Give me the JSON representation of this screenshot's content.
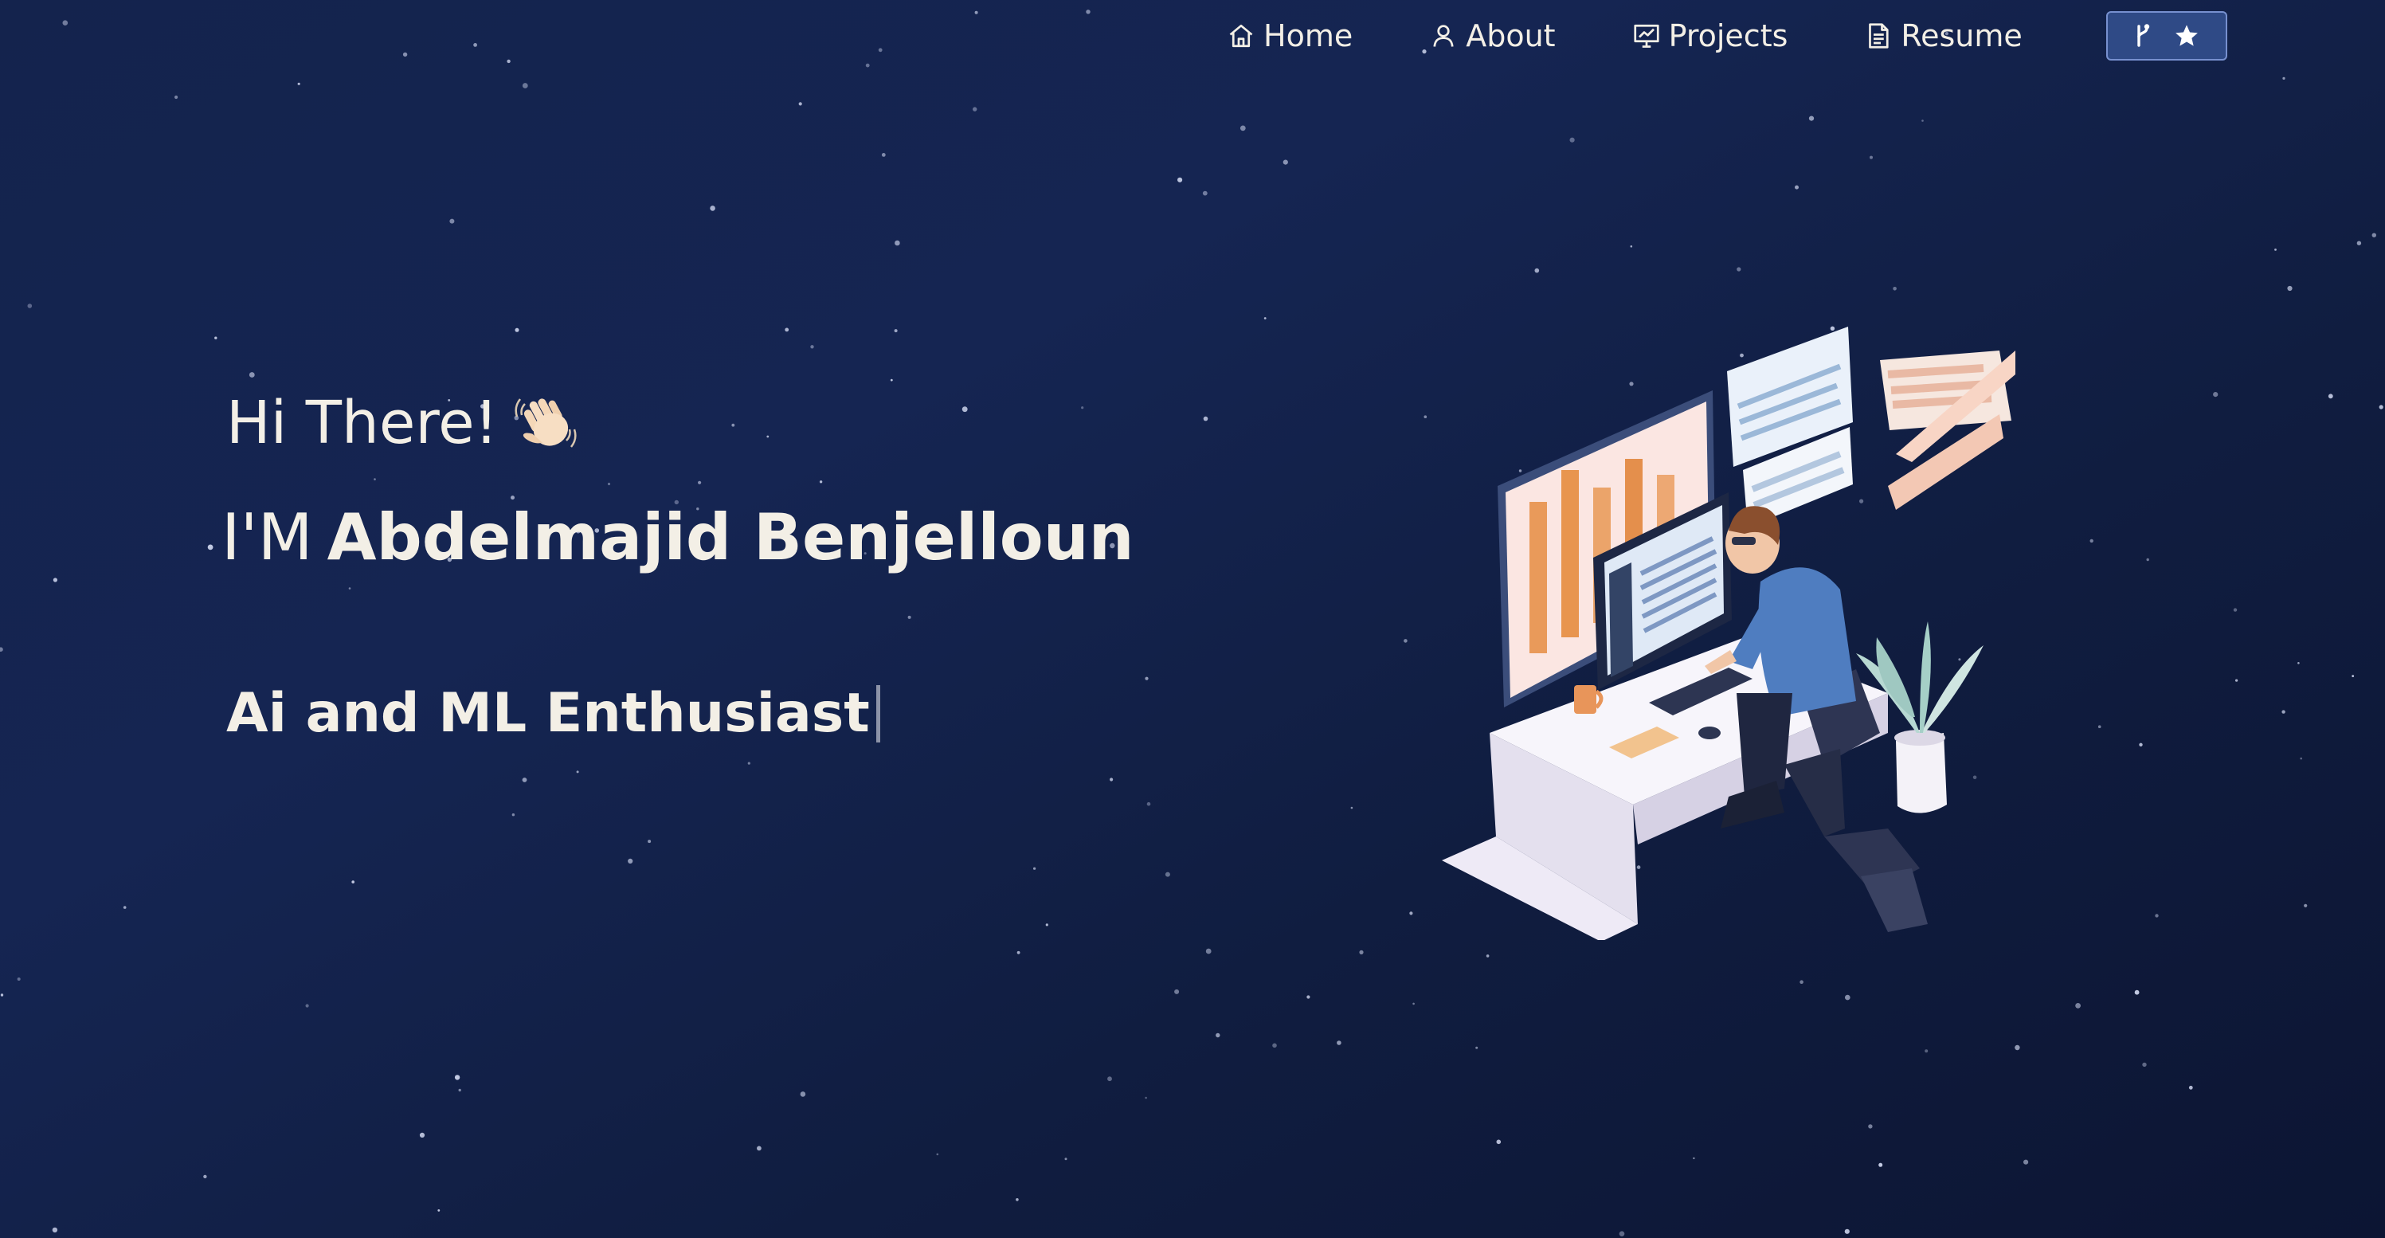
{
  "nav": {
    "items": [
      {
        "label": "Home",
        "icon": "home-icon"
      },
      {
        "label": "About",
        "icon": "user-icon"
      },
      {
        "label": "Projects",
        "icon": "presentation-icon"
      },
      {
        "label": "Resume",
        "icon": "document-icon"
      }
    ],
    "github_button": {
      "icons": [
        "fork-icon",
        "star-icon"
      ]
    }
  },
  "hero": {
    "greeting": "Hi There!",
    "greeting_emoji": "waving-hand",
    "name_prefix": "I'M",
    "name": "Abdelmajid Benjelloun",
    "typed_role": "Ai and ML Enthusiast"
  },
  "illustration": {
    "subject": "person-working-at-desk-with-monitors"
  },
  "colors": {
    "background_top": "#14234d",
    "background_bottom": "#0c1533",
    "text": "#f3efe6",
    "button_bg": "#2f4a86",
    "button_border": "#7790cf"
  }
}
